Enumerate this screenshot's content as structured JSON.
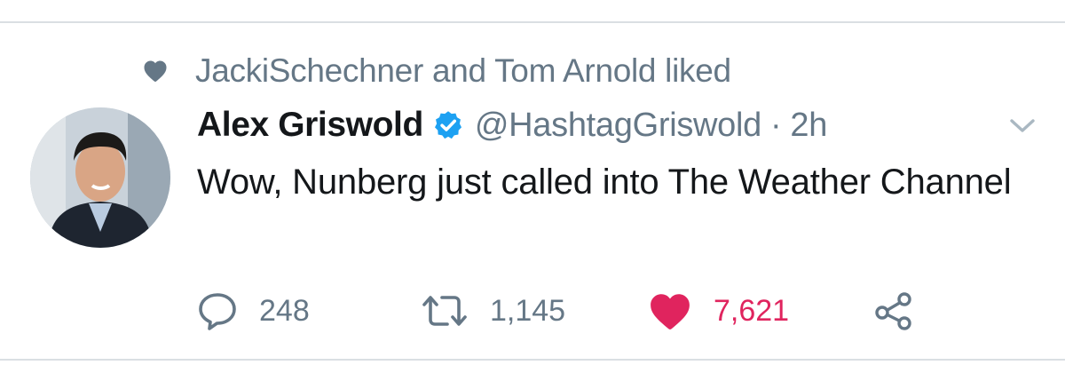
{
  "social_context": {
    "icon": "heart-icon",
    "text": "JackiSchechner and Tom Arnold liked"
  },
  "tweet": {
    "author": {
      "display_name": "Alex Griswold",
      "verified": true,
      "handle": "@HashtagGriswold",
      "avatar": "avatar-photo"
    },
    "separator": "·",
    "time": "2h",
    "text": "Wow, Nunberg just called into The Weather Channel"
  },
  "actions": {
    "reply": {
      "icon": "reply-icon",
      "count": "248"
    },
    "retweet": {
      "icon": "retweet-icon",
      "count": "1,145"
    },
    "like": {
      "icon": "heart-icon",
      "count": "7,621",
      "liked": true
    },
    "share": {
      "icon": "share-icon"
    }
  },
  "colors": {
    "text_primary": "#14171a",
    "text_secondary": "#657786",
    "verified": "#1da1f2",
    "like": "#e0245e",
    "divider": "#dadfe3"
  }
}
